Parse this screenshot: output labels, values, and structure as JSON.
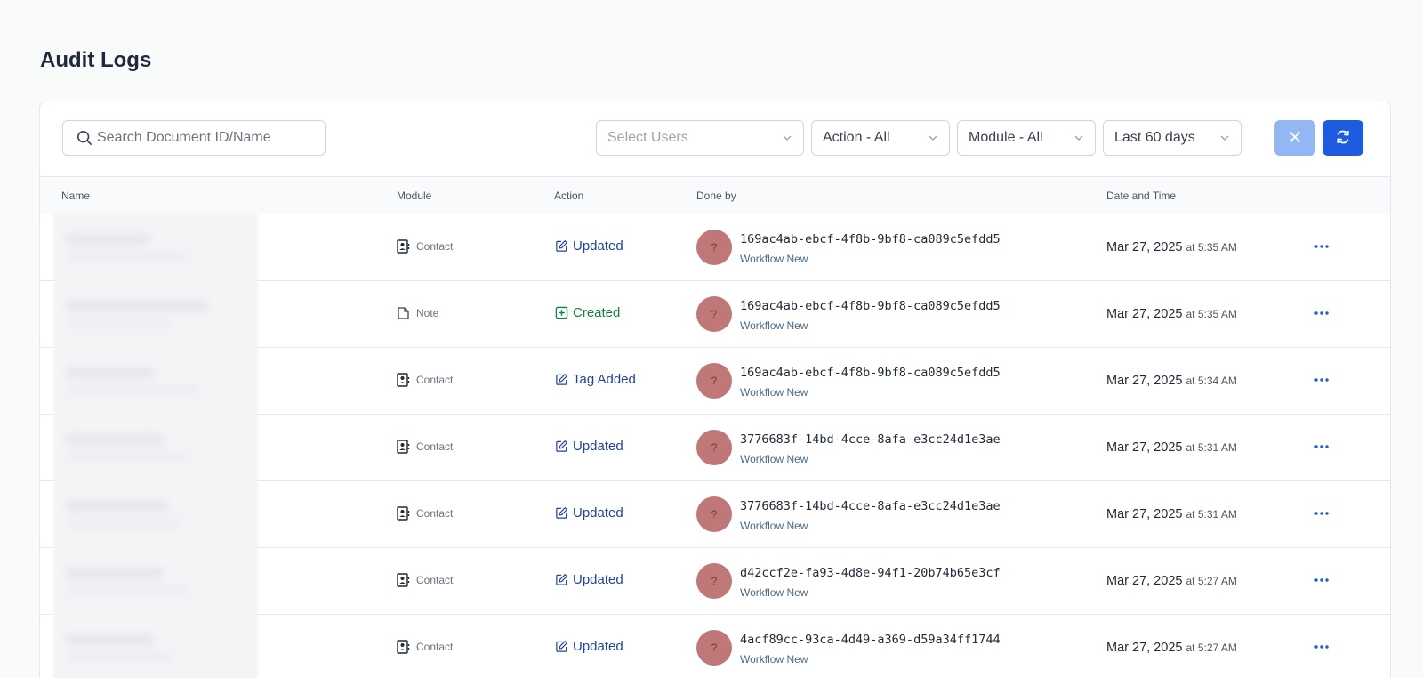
{
  "page": {
    "title": "Audit Logs"
  },
  "toolbar": {
    "search_placeholder": "Search Document ID/Name",
    "users_placeholder": "Select Users",
    "action_filter": "Action - All",
    "module_filter": "Module - All",
    "date_filter": "Last 60 days"
  },
  "columns": {
    "name": "Name",
    "module": "Module",
    "action": "Action",
    "done_by": "Done by",
    "date_time": "Date and Time"
  },
  "rows": [
    {
      "module": "Contact",
      "module_icon": "contact-card-icon",
      "action": "Updated",
      "action_type": "updated",
      "user_id": "169ac4ab-ebcf-4f8b-9bf8-ca089c5efdd5",
      "user_sub": "Workflow New",
      "avatar": "?",
      "date": "Mar 27, 2025",
      "time": "at 5:35 AM"
    },
    {
      "module": "Note",
      "module_icon": "note-icon",
      "action": "Created",
      "action_type": "created",
      "user_id": "169ac4ab-ebcf-4f8b-9bf8-ca089c5efdd5",
      "user_sub": "Workflow New",
      "avatar": "?",
      "date": "Mar 27, 2025",
      "time": "at 5:35 AM"
    },
    {
      "module": "Contact",
      "module_icon": "contact-card-icon",
      "action": "Tag Added",
      "action_type": "updated",
      "user_id": "169ac4ab-ebcf-4f8b-9bf8-ca089c5efdd5",
      "user_sub": "Workflow New",
      "avatar": "?",
      "date": "Mar 27, 2025",
      "time": "at 5:34 AM"
    },
    {
      "module": "Contact",
      "module_icon": "contact-card-icon",
      "action": "Updated",
      "action_type": "updated",
      "user_id": "3776683f-14bd-4cce-8afa-e3cc24d1e3ae",
      "user_sub": "Workflow New",
      "avatar": "?",
      "date": "Mar 27, 2025",
      "time": "at 5:31 AM"
    },
    {
      "module": "Contact",
      "module_icon": "contact-card-icon",
      "action": "Updated",
      "action_type": "updated",
      "user_id": "3776683f-14bd-4cce-8afa-e3cc24d1e3ae",
      "user_sub": "Workflow New",
      "avatar": "?",
      "date": "Mar 27, 2025",
      "time": "at 5:31 AM"
    },
    {
      "module": "Contact",
      "module_icon": "contact-card-icon",
      "action": "Updated",
      "action_type": "updated",
      "user_id": "d42ccf2e-fa93-4d8e-94f1-20b74b65e3cf",
      "user_sub": "Workflow New",
      "avatar": "?",
      "date": "Mar 27, 2025",
      "time": "at 5:27 AM"
    },
    {
      "module": "Contact",
      "module_icon": "contact-card-icon",
      "action": "Updated",
      "action_type": "updated",
      "user_id": "4acf89cc-93ca-4d49-a369-d59a34ff1744",
      "user_sub": "Workflow New",
      "avatar": "?",
      "date": "Mar 27, 2025",
      "time": "at 5:27 AM"
    }
  ],
  "colors": {
    "primary": "#1d5be0",
    "primary_light": "#93b6f5",
    "updated": "#1e40af",
    "created": "#15803d",
    "avatar_bg": "#c07778"
  }
}
